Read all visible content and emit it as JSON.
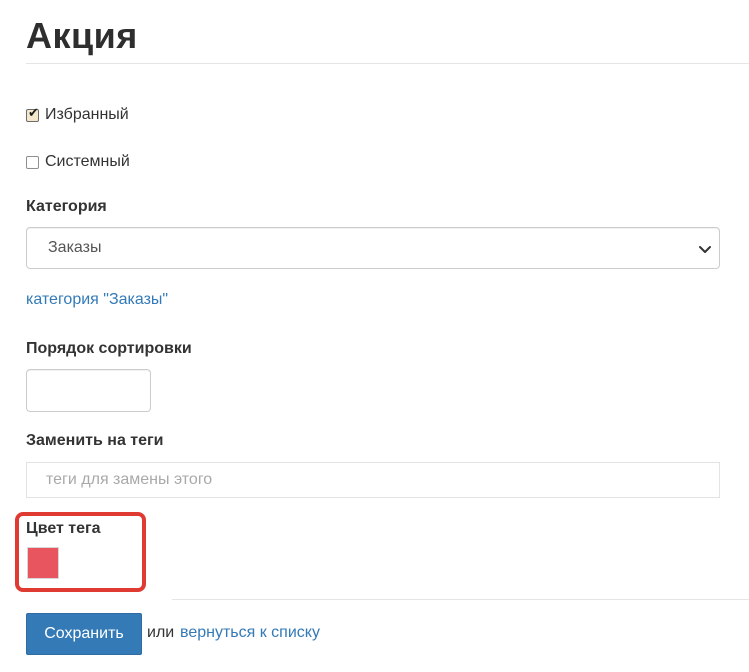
{
  "page": {
    "title": "Акция"
  },
  "form": {
    "favorite": {
      "label": "Избранный",
      "checked": true
    },
    "system": {
      "label": "Системный",
      "checked": false
    },
    "category": {
      "label": "Категория",
      "selected": "Заказы",
      "link_text": "категория \"Заказы\""
    },
    "sort_order": {
      "label": "Порядок сортировки",
      "value": ""
    },
    "replace_tags": {
      "label": "Заменить на теги",
      "placeholder": "теги для замены этого",
      "value": ""
    },
    "tag_color": {
      "label": "Цвет тега",
      "color": "#e8555f",
      "highlight_color": "#e03b32"
    }
  },
  "actions": {
    "save_label": "Сохранить",
    "or_text": "или",
    "back_link": "вернуться к списку"
  },
  "colors": {
    "link": "#337ab7",
    "primary_button": "#337ab7"
  },
  "icons": {
    "select_arrow": "chevron-down-icon",
    "checkbox_tick": "check-icon"
  }
}
